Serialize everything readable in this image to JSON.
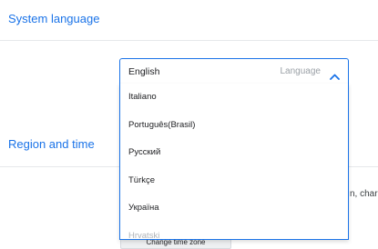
{
  "sections": {
    "system_language": {
      "title": "System language"
    },
    "region_time": {
      "title": "Region and time"
    }
  },
  "language_select": {
    "selected": "English",
    "label": "Language",
    "options": [
      "Italiano",
      "Português(Brasil)",
      "Русский",
      "Türkçe",
      "Україна",
      "Hrvatski"
    ]
  },
  "behind_text": "n, char",
  "change_time_zone_button": {
    "label": "Change time zone"
  },
  "colors": {
    "accent": "#1a73e8",
    "text": "#202124",
    "muted": "#9aa0a6"
  },
  "icons": {
    "dropdown_toggle": "chevron-up-icon"
  }
}
